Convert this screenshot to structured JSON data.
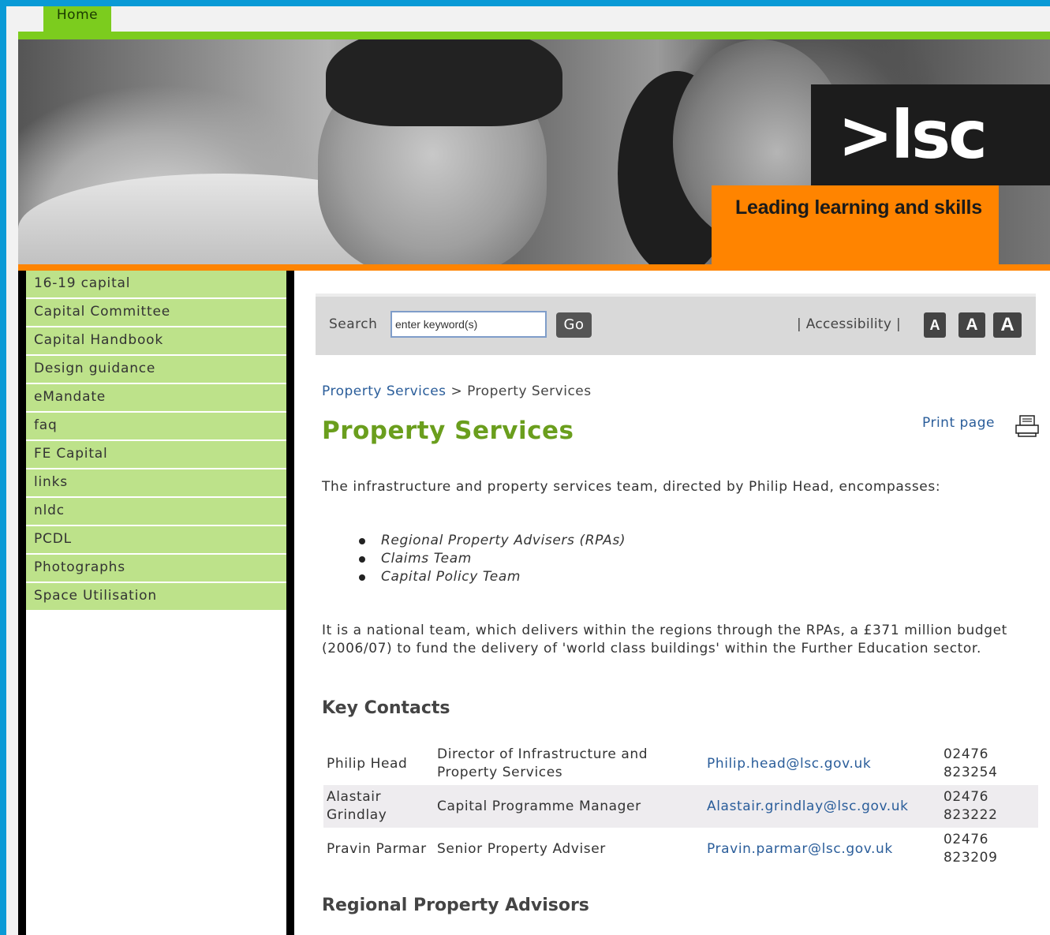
{
  "nav": {
    "home_tab": "Home"
  },
  "banner": {
    "logo_text": ">lsc",
    "tagline": "Leading learning and skills"
  },
  "sidebar": {
    "items": [
      {
        "label": "16-19 capital"
      },
      {
        "label": "Capital Committee"
      },
      {
        "label": "Capital Handbook"
      },
      {
        "label": "Design guidance"
      },
      {
        "label": "eMandate"
      },
      {
        "label": "faq"
      },
      {
        "label": "FE Capital"
      },
      {
        "label": "links"
      },
      {
        "label": "nldc"
      },
      {
        "label": "PCDL"
      },
      {
        "label": "Photographs"
      },
      {
        "label": "Space Utilisation"
      }
    ]
  },
  "search": {
    "label": "Search",
    "value": "enter keyword(s)",
    "go_label": "Go",
    "accessibility_label": "| Accessibility |",
    "font_buttons": [
      "A",
      "A",
      "A"
    ]
  },
  "breadcrumb": {
    "items": [
      "Property Services",
      "Property Services"
    ],
    "separator": ">"
  },
  "main": {
    "title": "Property Services",
    "print_label": "Print page",
    "intro": "The infrastructure and property services team, directed by Philip Head, encompasses:",
    "team_list": [
      "Regional Property Advisers (RPAs)",
      "Claims Team",
      "Capital Policy Team"
    ],
    "body": "It is a national team, which delivers within the regions through the RPAs, a £371 million budget (2006/07) to fund the delivery of 'world class buildings' within the Further Education sector.",
    "key_contacts_heading": "Key Contacts",
    "contacts": [
      {
        "name": "Philip Head",
        "role": "Director of Infrastructure and Property Services",
        "email": "Philip.head@lsc.gov.uk",
        "phone": "02476 823254"
      },
      {
        "name": "Alastair Grindlay",
        "role": "Capital Programme Manager",
        "email": "Alastair.grindlay@lsc.gov.uk",
        "phone": "02476 823222"
      },
      {
        "name": "Pravin Parmar",
        "role": "Senior Property Adviser",
        "email": "Pravin.parmar@lsc.gov.uk",
        "phone": "02476 823209"
      }
    ],
    "rpa_heading": "Regional Property Advisors"
  },
  "colors": {
    "page_background": "#0a9ad6",
    "brand_green": "#7ccc1e",
    "nav_green": "#bde28a",
    "brand_orange": "#ff8400",
    "title_green": "#6a9e1d",
    "link_blue": "#2a5d9a"
  },
  "icons": {
    "print": "printer-icon"
  }
}
